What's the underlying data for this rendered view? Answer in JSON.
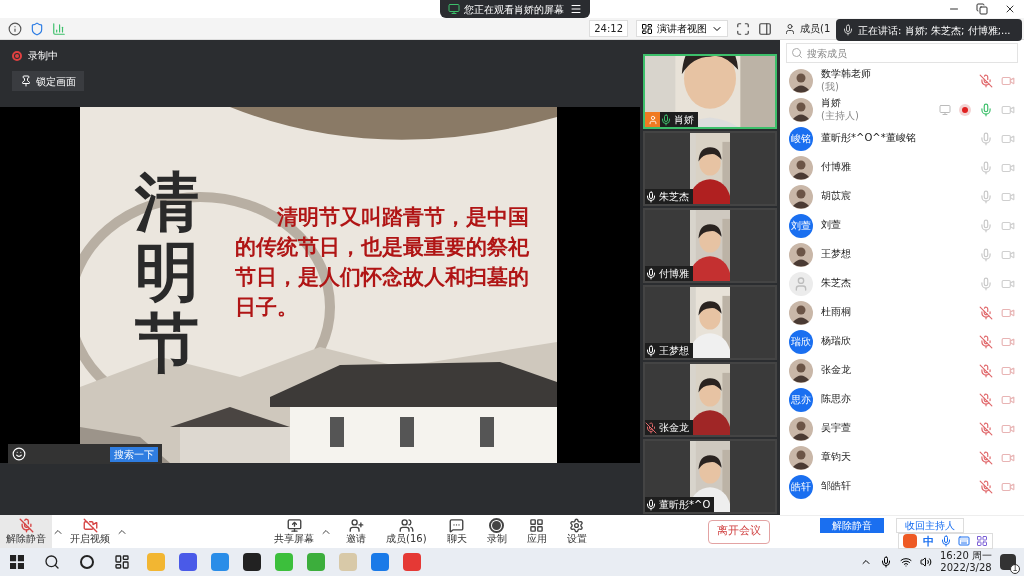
{
  "top_banner": {
    "text": "您正在观看肖娇的屏幕"
  },
  "toolbar": {
    "timer": "24:12",
    "view_button": "演讲者视图",
    "panel_tab": "成员(1"
  },
  "speaking_tooltip": "正在讲话: 肖娇; 朱芝杰; 付博雅;...",
  "recording_badge": "录制中",
  "lock_button": "锁定画面",
  "slide": {
    "calligraphy": "清明节",
    "text": "清明节又叫踏青节，是中国的传统节日，也是最重要的祭祀节日，是人们怀念故人和扫墓的日子。",
    "search_button": "搜索一下"
  },
  "video_tiles": [
    {
      "name": "肖娇",
      "active": true,
      "muted": false,
      "talking": true
    },
    {
      "name": "朱芝杰",
      "active": false,
      "muted": false,
      "talking": false
    },
    {
      "name": "付博雅",
      "active": false,
      "muted": false,
      "talking": false
    },
    {
      "name": "王梦想",
      "active": false,
      "muted": false,
      "talking": false
    },
    {
      "name": "张金龙",
      "active": false,
      "muted": true,
      "talking": false
    },
    {
      "name": "董昕彤*^O",
      "active": false,
      "muted": false,
      "talking": false
    }
  ],
  "members_panel": {
    "search_placeholder": "搜索成员",
    "members": [
      {
        "name": "数学韩老师",
        "role": "(我)",
        "muted": true,
        "talking": false,
        "sharing": false,
        "recording": false
      },
      {
        "name": "肖娇",
        "role": "(主持人)",
        "muted": false,
        "talking": true,
        "sharing": true,
        "recording": true
      },
      {
        "name": "董昕彤*^O^*董峻铭",
        "avatar": {
          "kind": "text",
          "text": "峻铭"
        },
        "muted": false,
        "talking": false,
        "sharing": false,
        "recording": false
      },
      {
        "name": "付博雅",
        "muted": false,
        "talking": false,
        "sharing": false,
        "recording": false
      },
      {
        "name": "胡苡宸",
        "muted": false,
        "talking": false,
        "sharing": false,
        "recording": false
      },
      {
        "name": "刘萱",
        "avatar": {
          "kind": "text",
          "text": "刘萱"
        },
        "muted": false,
        "talking": false,
        "sharing": false,
        "recording": false
      },
      {
        "name": "王梦想",
        "muted": false,
        "talking": false,
        "sharing": false,
        "recording": false
      },
      {
        "name": "朱芝杰",
        "avatar": {
          "kind": "default"
        },
        "muted": false,
        "talking": false,
        "sharing": false,
        "recording": false
      },
      {
        "name": "杜雨桐",
        "muted": true,
        "talking": false,
        "sharing": false,
        "recording": false
      },
      {
        "name": "杨瑞欣",
        "avatar": {
          "kind": "text",
          "text": "瑞欣"
        },
        "muted": true,
        "talking": false,
        "sharing": false,
        "recording": false
      },
      {
        "name": "张金龙",
        "muted": true,
        "talking": false,
        "sharing": false,
        "recording": false
      },
      {
        "name": "陈思亦",
        "avatar": {
          "kind": "text",
          "text": "思亦"
        },
        "muted": true,
        "talking": false,
        "sharing": false,
        "recording": false
      },
      {
        "name": "吴宇萱",
        "muted": true,
        "talking": false,
        "sharing": false,
        "recording": false
      },
      {
        "name": "章钧天",
        "muted": true,
        "talking": false,
        "sharing": false,
        "recording": false
      },
      {
        "name": "邹皓轩",
        "avatar": {
          "kind": "text",
          "text": "皓轩"
        },
        "muted": true,
        "talking": false,
        "sharing": false,
        "recording": false
      }
    ],
    "unmute_all_button": "解除静音",
    "reclaim_host_button": "收回主持人"
  },
  "meeting_controls": [
    {
      "kind": "mic-off",
      "label": "解除静音"
    },
    {
      "kind": "video-off",
      "label": "开启视频"
    },
    {
      "kind": "share",
      "label": "共享屏幕"
    },
    {
      "kind": "invite",
      "label": "邀请"
    },
    {
      "kind": "members",
      "label": "成员(16)"
    },
    {
      "kind": "chat",
      "label": "聊天"
    },
    {
      "kind": "record",
      "label": "录制"
    },
    {
      "kind": "apps",
      "label": "应用"
    },
    {
      "kind": "settings",
      "label": "设置"
    }
  ],
  "leave_button": "离开会议",
  "ime_bar": {
    "mode": "中"
  },
  "taskbar": {
    "time": "16:20 周一",
    "date": "2022/3/28",
    "notifications": "1"
  }
}
